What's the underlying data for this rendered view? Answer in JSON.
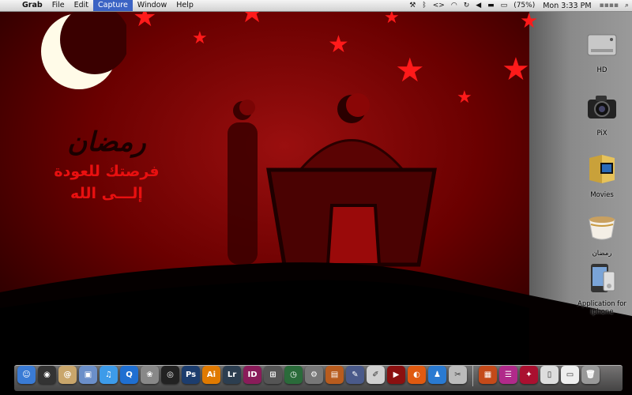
{
  "menubar": {
    "apple": "",
    "app": "Grab",
    "menus": [
      "File",
      "Edit",
      "Capture",
      "Window",
      "Help"
    ],
    "battery": "(75%)",
    "clock": "Mon 3:33 PM"
  },
  "wallpaper": {
    "arabic_logo": "رمضان",
    "arabic_line1": "فرصتك للعودة",
    "arabic_line2": "إلـــى الله"
  },
  "desktop_icons": [
    {
      "label": "HD",
      "icon": "hard-drive-icon"
    },
    {
      "label": "PiX",
      "icon": "camera-icon"
    },
    {
      "label": "Movies",
      "icon": "movies-folder-icon"
    },
    {
      "label": "رمضان",
      "icon": "tea-cup-icon"
    },
    {
      "label": "Application for Iphone",
      "icon": "iphone-icon"
    }
  ],
  "dock": [
    {
      "name": "finder",
      "glyph": "☺",
      "color": "#3a7bd5"
    },
    {
      "name": "dashboard",
      "glyph": "◉",
      "color": "#333333"
    },
    {
      "name": "address-book",
      "glyph": "@",
      "color": "#c9a66b"
    },
    {
      "name": "preview",
      "glyph": "▣",
      "color": "#6b8fc9"
    },
    {
      "name": "itunes",
      "glyph": "♫",
      "color": "#3d9be9"
    },
    {
      "name": "quicktime",
      "glyph": "Q",
      "color": "#1f6fd1"
    },
    {
      "name": "iphoto",
      "glyph": "❀",
      "color": "#888888"
    },
    {
      "name": "aperture",
      "glyph": "◎",
      "color": "#222222"
    },
    {
      "name": "photoshop",
      "glyph": "Ps",
      "color": "#1c3d6e"
    },
    {
      "name": "illustrator",
      "glyph": "Ai",
      "color": "#e07a00"
    },
    {
      "name": "lightroom",
      "glyph": "Lr",
      "color": "#2c3e50"
    },
    {
      "name": "indesign",
      "glyph": "ID",
      "color": "#8a1c5a"
    },
    {
      "name": "spaces",
      "glyph": "⊞",
      "color": "#555555"
    },
    {
      "name": "time-machine",
      "glyph": "◷",
      "color": "#2a6b3a"
    },
    {
      "name": "system-preferences",
      "glyph": "⚙",
      "color": "#777777"
    },
    {
      "name": "presentation",
      "glyph": "▤",
      "color": "#b85c1e"
    },
    {
      "name": "script-editor",
      "glyph": "✎",
      "color": "#4a5a8a"
    },
    {
      "name": "textedit",
      "glyph": "✐",
      "color": "#d0d0d0"
    },
    {
      "name": "front-row",
      "glyph": "▶",
      "color": "#8a1010"
    },
    {
      "name": "firefox",
      "glyph": "◐",
      "color": "#e05a10"
    },
    {
      "name": "messenger",
      "glyph": "♟",
      "color": "#2a7ad1"
    },
    {
      "name": "utility",
      "glyph": "✂",
      "color": "#bbbbbb"
    },
    {
      "name": "applications-folder",
      "glyph": "▦",
      "color": "#c44a1a"
    },
    {
      "name": "documents-stack",
      "glyph": "☰",
      "color": "#b02a8a"
    },
    {
      "name": "bookmark-app",
      "glyph": "✦",
      "color": "#aa1030"
    },
    {
      "name": "file",
      "glyph": "▯",
      "color": "#dddddd"
    },
    {
      "name": "downloads",
      "glyph": "▭",
      "color": "#eeeeee"
    },
    {
      "name": "trash",
      "glyph": "🗑",
      "color": "#999999"
    }
  ]
}
